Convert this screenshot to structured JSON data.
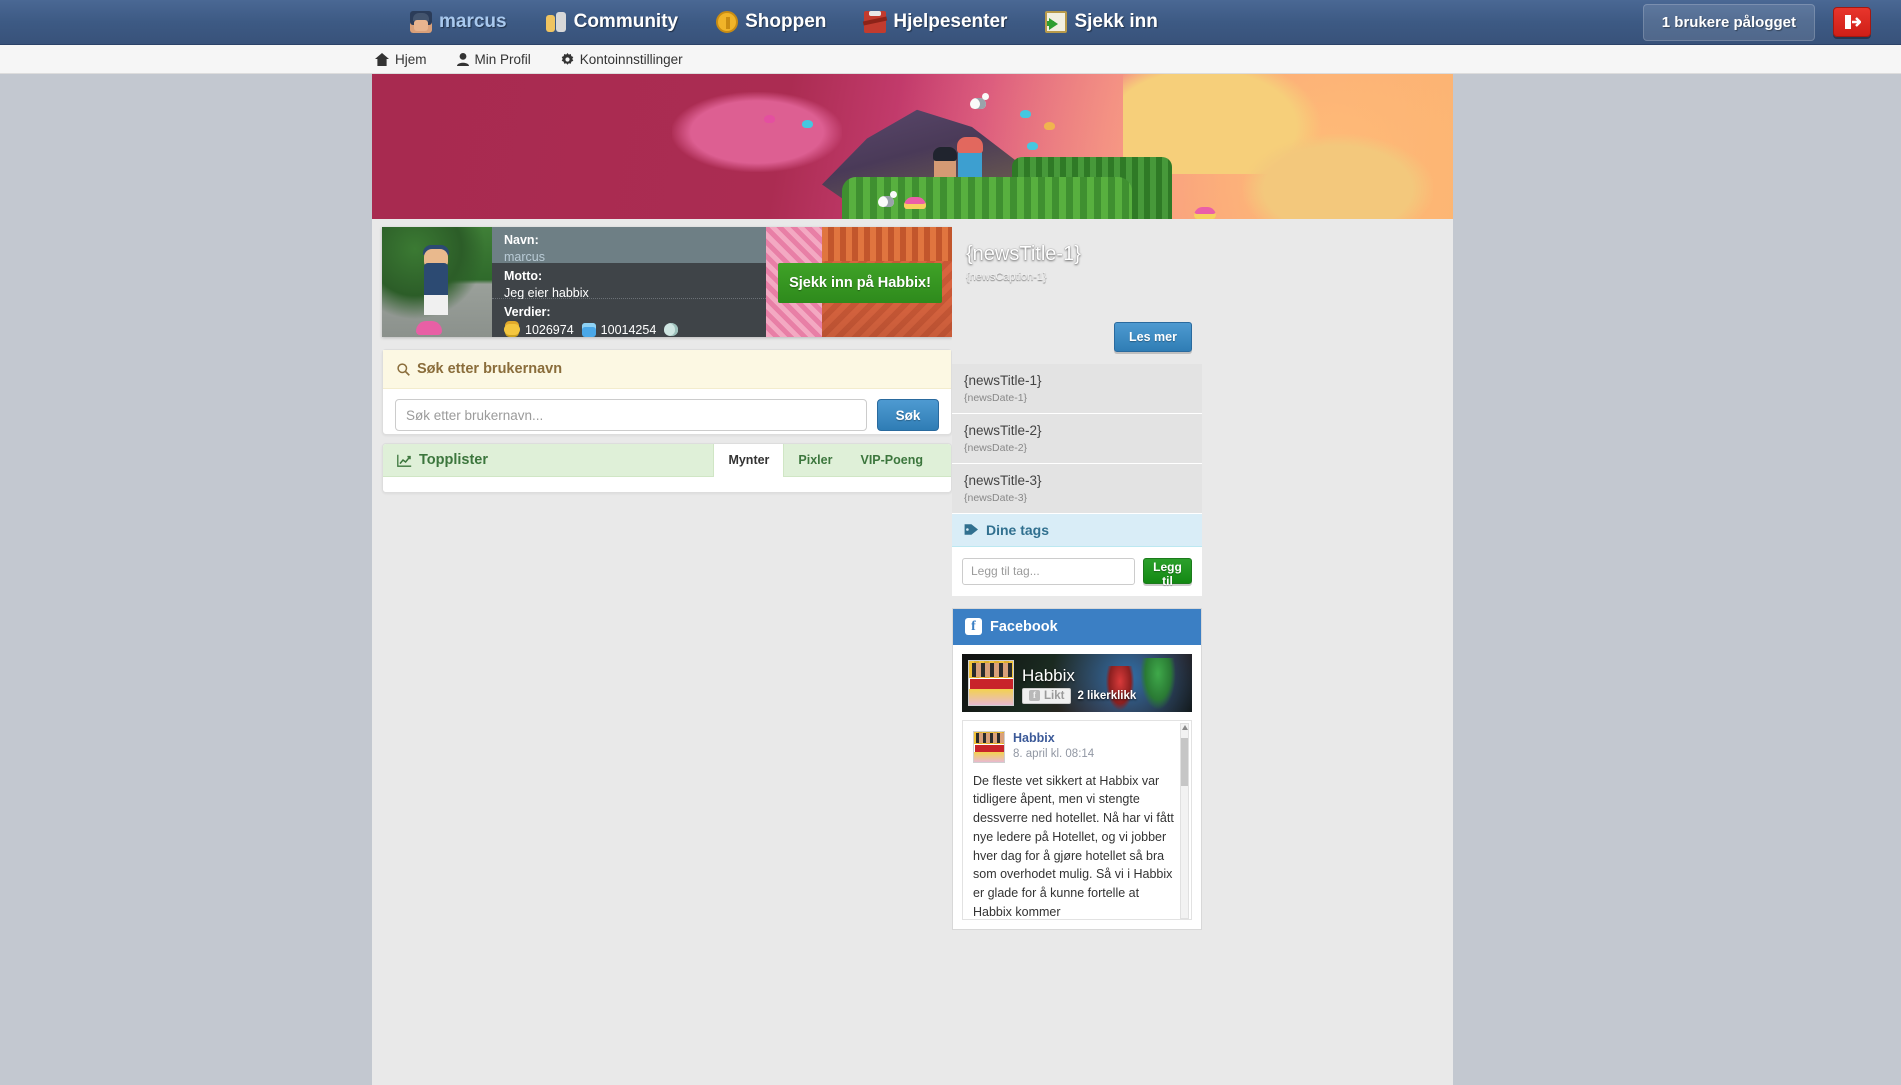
{
  "topnav": {
    "links": [
      {
        "label": "marcus",
        "icon": "avatar-icon"
      },
      {
        "label": "Community",
        "icon": "community-icon"
      },
      {
        "label": "Shoppen",
        "icon": "coin-icon"
      },
      {
        "label": "Hjelpesenter",
        "icon": "toolbox-icon"
      },
      {
        "label": "Sjekk inn",
        "icon": "check-in-icon"
      }
    ],
    "users_online": "1 brukere pålogget",
    "logout_title": "logout-icon"
  },
  "subnav": {
    "links": [
      {
        "label": "Hjem",
        "icon": "home-icon"
      },
      {
        "label": "Min Profil",
        "icon": "user-icon"
      },
      {
        "label": "Kontoinnstillinger",
        "icon": "gear-icon"
      }
    ]
  },
  "profile": {
    "name_label": "Navn:",
    "name_value": "marcus",
    "motto_label": "Motto:",
    "motto_value": "Jeg eier habbix",
    "values_label": "Verdier:",
    "coins": "1026974",
    "diamonds": "10014254",
    "seashells": "",
    "checkin_button": "Sjekk inn på Habbix!"
  },
  "search": {
    "heading": "Søk etter brukernavn",
    "placeholder": "Søk etter brukernavn...",
    "value": "",
    "button": "Søk"
  },
  "toplist": {
    "heading": "Topplister",
    "tabs": [
      {
        "label": "Mynter",
        "active": true
      },
      {
        "label": "Pixler",
        "active": false
      },
      {
        "label": "VIP-Poeng",
        "active": false
      }
    ]
  },
  "news_hero": {
    "title": "{newsTitle-1}",
    "caption": "{newsCaption-1}",
    "button": "Les mer"
  },
  "news_items": [
    {
      "title": "{newsTitle-1}",
      "date": "{newsDate-1}"
    },
    {
      "title": "{newsTitle-2}",
      "date": "{newsDate-2}"
    },
    {
      "title": "{newsTitle-3}",
      "date": "{newsDate-3}"
    }
  ],
  "tags": {
    "heading": "Dine tags",
    "placeholder": "Legg til tag...",
    "value": "",
    "button": "Legg til"
  },
  "facebook": {
    "heading": "Facebook",
    "page_name": "Habbix",
    "like_button": "Likt",
    "likes": "2 likerklikk",
    "post": {
      "author": "Habbix",
      "date": "8. april kl. 08:14",
      "text": "De fleste vet sikkert at Habbix var tidligere åpent, men vi stengte dessverre ned hotellet. Nå har vi fått nye ledere på Hotellet, og vi jobber hver dag for å gjøre hotellet så bra som overhodet mulig.\nSå vi i Habbix er glade for å kunne fortelle at Habbix kommer"
    }
  },
  "colors": {
    "nav_blue": "#3d5a84",
    "accent_blue": "#3b7fc4",
    "green": "#2ca02c",
    "red": "#cf1f17",
    "warning_bg": "#fcf8e3",
    "success_bg": "#dff0d8",
    "info_bg": "#d9edf7"
  }
}
